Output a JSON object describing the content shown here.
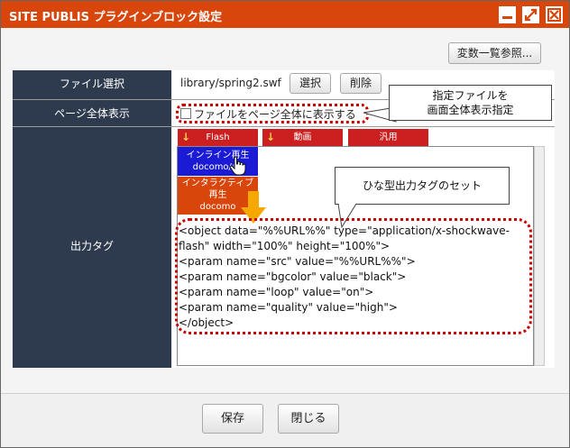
{
  "window": {
    "title": "SITE PUBLIS プラグインブロック設定"
  },
  "toolbar": {
    "variables_button": "変数一覧参照..."
  },
  "rows": {
    "file_select": {
      "label": "ファイル選択",
      "path": "library/spring2.swf",
      "select_button": "選択",
      "delete_button": "削除"
    },
    "fullscreen": {
      "label": "ページ全体表示",
      "checkbox_label": "ファイルをページ全体に表示する",
      "checked": false
    },
    "output": {
      "label": "出力タグ",
      "tabs": [
        "Flash",
        "動画",
        "汎用"
      ],
      "templates": [
        {
          "lines": [
            "インライン再生",
            "docomo/au"
          ]
        },
        {
          "lines": [
            "インタラクティブ",
            "再生",
            "docomo"
          ]
        }
      ],
      "code_lines": [
        "<object data=\"%%URL%%\" type=\"application/x-shockwave-",
        "flash\" width=\"100%\" height=\"100%\">",
        "<param name=\"src\" value=\"%%URL%%\">",
        "<param name=\"bgcolor\" value=\"black\">",
        "<param name=\"loop\" value=\"on\">",
        "<param name=\"quality\" value=\"high\">",
        "</object>"
      ]
    }
  },
  "callouts": {
    "fullscreen_note": [
      "指定ファイルを",
      "画面全体表示指定"
    ],
    "template_note": "ひな型出力タグのセット"
  },
  "footer": {
    "save_button": "保存",
    "close_button": "閉じる"
  },
  "colors": {
    "titlebar": "#d9460c",
    "label_bg": "#2e3a4d",
    "tab_red": "#cc1f1f",
    "template_blue": "#1b1bd6",
    "template_orange": "#d9460c",
    "highlight_red": "#cc0000",
    "arrow_yellow": "#f5a800"
  }
}
